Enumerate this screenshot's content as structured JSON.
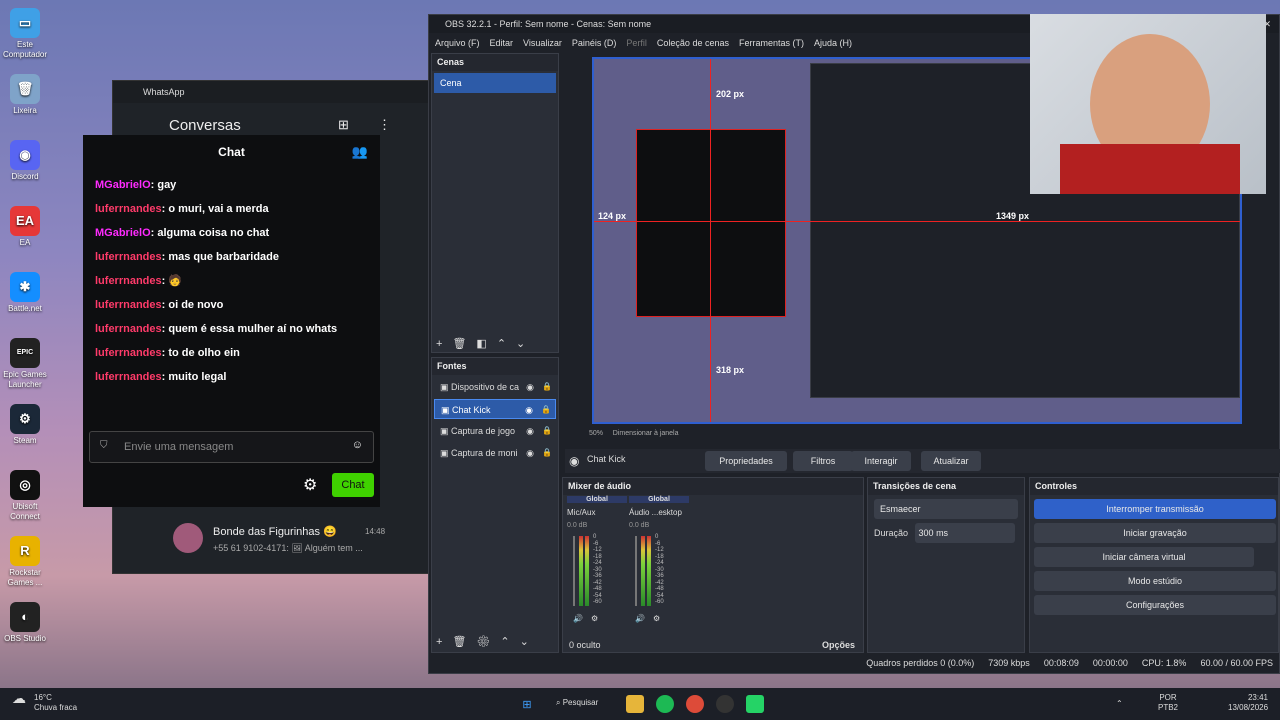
{
  "desktop": {
    "icons": [
      {
        "label": "Este Computador",
        "glyph": "▭",
        "color": "#3fa0e6"
      },
      {
        "label": "Lixeira",
        "glyph": "🗑",
        "color": "#7fa3c9"
      },
      {
        "label": "Discord",
        "glyph": "◉",
        "color": "#5865f2"
      },
      {
        "label": "EA",
        "glyph": "EA",
        "color": "#e63838"
      },
      {
        "label": "Battle.net",
        "glyph": "✱",
        "color": "#148eff"
      },
      {
        "label": "Epic Games Launcher",
        "glyph": "EPIC",
        "color": "#222"
      },
      {
        "label": "Steam",
        "glyph": "⚙",
        "color": "#1b2838"
      },
      {
        "label": "Ubisoft Connect",
        "glyph": "◎",
        "color": "#111"
      },
      {
        "label": "Rockstar Games ...",
        "glyph": "R",
        "color": "#e8b200"
      },
      {
        "label": "OBS Studio",
        "glyph": "◐",
        "color": "#222"
      }
    ]
  },
  "whatsapp": {
    "title": "WhatsApp",
    "header": "Conversas",
    "contact": {
      "name": "Bonde das Figurinhas 😄",
      "time": "14:48",
      "preview": "+55 61 9102-4171: 🖼 Alguém tem ..."
    }
  },
  "chat": {
    "title": "Chat",
    "input_placeholder": "Envie uma mensagem",
    "send_label": "Chat",
    "messages": [
      {
        "user": "MGabrielO",
        "text": ": gay",
        "cls": "u1"
      },
      {
        "user": "luferrnandes",
        "text": ": o muri, vai a merda",
        "cls": "u2"
      },
      {
        "user": "MGabrielO",
        "text": ": alguma coisa no chat",
        "cls": "u1"
      },
      {
        "user": "luferrnandes",
        "text": ": mas que barbaridade",
        "cls": "u2"
      },
      {
        "user": "luferrnandes",
        "text": ": 🧑",
        "cls": "u2"
      },
      {
        "user": "luferrnandes",
        "text": ": oi de novo",
        "cls": "u2"
      },
      {
        "user": "luferrnandes",
        "text": ": quem é essa mulher aí no whats",
        "cls": "u2"
      },
      {
        "user": "luferrnandes",
        "text": ": to de olho ein",
        "cls": "u2"
      },
      {
        "user": "luferrnandes",
        "text": ": muito legal",
        "cls": "u2"
      }
    ]
  },
  "obs": {
    "title": "OBS 32.2.1 - Perfil: Sem nome - Cenas: Sem nome",
    "menu": [
      "Arquivo (F)",
      "Editar",
      "Visualizar",
      "Painéis (D)",
      "Perfil",
      "Coleção de cenas",
      "Ferramentas (T)",
      "Ajuda (H)"
    ],
    "scenes_title": "Cenas",
    "scenes": [
      "Cena"
    ],
    "sources_title": "Fontes",
    "sources": [
      "Dispositivo de ca",
      "Chat Kick",
      "Captura de jogo",
      "Captura de moni"
    ],
    "preview_labels": {
      "top": "202 px",
      "left": "124 px",
      "right": "1349 px",
      "bottom": "318 px"
    },
    "zoom": "50%",
    "scale_mode": "Dimensionar à janela",
    "selected_source": "Chat Kick",
    "source_buttons": [
      "Propriedades",
      "Filtros",
      "Interagir",
      "Atualizar"
    ],
    "mixer_title": "Mixer de áudio",
    "mixer": [
      {
        "label": "Global",
        "name": "Mic/Aux",
        "db": "0.0 dB"
      },
      {
        "label": "Global",
        "name": "Áudio ...esktop",
        "db": "0.0 dB"
      }
    ],
    "mixer_scale": [
      "0",
      "-6",
      "-12",
      "-18",
      "-24",
      "-30",
      "-36",
      "-42",
      "-48",
      "-54",
      "-60"
    ],
    "hidden": "0 oculto",
    "options": "Opções",
    "transitions_title": "Transições de cena",
    "transition": "Esmaecer",
    "duration_label": "Duração",
    "duration": "300 ms",
    "controls_title": "Controles",
    "controls": [
      "Interromper transmissão",
      "Iniciar gravação",
      "Iniciar câmera virtual",
      "Modo estúdio",
      "Configurações"
    ],
    "status": {
      "frames": "Quadros perdidos 0 (0.0%)",
      "kbps": "7309 kbps",
      "stream_time": "00:08:09",
      "rec_time": "00:00:00",
      "cpu": "CPU: 1.8%",
      "fps": "60.00 / 60.00 FPS"
    }
  },
  "taskbar": {
    "weather_temp": "16°C",
    "weather_desc": "Chuva fraca",
    "search": "Pesquisar",
    "lang": "POR",
    "layout": "PTB2",
    "time": "23:41",
    "date": "13/08/2026"
  }
}
